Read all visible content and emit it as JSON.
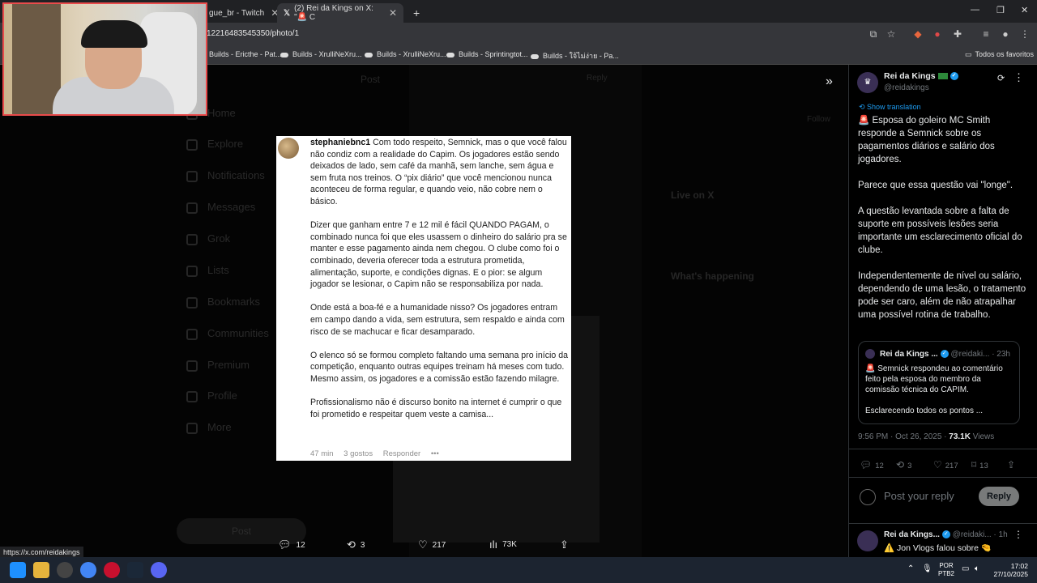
{
  "browser": {
    "tabs": [
      {
        "title": "gue_br - Twitch"
      },
      {
        "title": "(2) Rei da Kings on X: \"🚨 C"
      }
    ],
    "url": "12216483545350/photo/1",
    "bookmarks": [
      "Builds - Ericthe - Pat...",
      "Builds - XrulliNeXru...",
      "Builds - XrulliNeXru...",
      "Builds - Sprintingtot...",
      "Builds - ใจ้ไม่ง่าย - Pa..."
    ],
    "all_bookmarks": "Todos os favoritos"
  },
  "background": {
    "nav": [
      "Home",
      "Explore",
      "Notifications",
      "Messages",
      "Grok",
      "Lists",
      "Bookmarks",
      "Communities",
      "Premium",
      "Profile",
      "More"
    ],
    "post_button": "Post",
    "header": "Post",
    "reply": "Reply",
    "follow": "Follow",
    "live_on_x": "Live on X",
    "whats_happening": "What's happening"
  },
  "comment": {
    "username": "stephaniebnc1",
    "paragraphs": [
      "Com todo respeito, Semnick, mas o que você falou não condiz com a realidade do Capim. Os jogadores estão sendo deixados de lado, sem café da manhã, sem lanche, sem água e sem fruta nos treinos. O “pix diário” que você mencionou nunca aconteceu de forma regular, e quando veio, não cobre nem o básico.",
      "Dizer que ganham entre 7 e 12 mil é fácil QUANDO PAGAM, o combinado nunca foi que eles usassem o dinheiro do salário pra se manter e esse pagamento ainda nem chegou. O clube como foi o combinado, deveria oferecer toda a estrutura prometida, alimentação, suporte, e condições dignas. E o pior: se algum jogador se lesionar, o Capim não se responsabiliza por nada.",
      "Onde está a boa-fé e a humanidade nisso? Os jogadores entram em campo dando a vida, sem estrutura, sem respaldo e ainda com risco de se machucar e ficar desamparado.",
      "O elenco só se formou completo faltando uma semana pro início da competição, enquanto outras equipes treinam há meses com tudo. Mesmo assim, os jogadores e a comissão estão fazendo milagre.",
      "Profissionalismo não é discurso bonito na internet é cumprir o que foi prometido e respeitar quem veste a camisa..."
    ],
    "time": "47 min",
    "likes": "3 gostos",
    "reply": "Responder",
    "more": "•••"
  },
  "bottom_actions": {
    "replies": "12",
    "reposts": "3",
    "likes": "217",
    "views": "73K"
  },
  "right_panel": {
    "author_name": "Rei da Kings",
    "author_handle": "@reidakings",
    "show_translation": "Show translation",
    "paragraphs": [
      "🚨 Esposa do goleiro MC Smith responde a Semnick sobre os pagamentos diários e salário dos jogadores.",
      "Parece que essa questão vai \"longe\".",
      "A questão levantada sobre a falta de suporte em possíveis lesões seria importante um esclarecimento oficial do clube.",
      "Independentemente de nível ou salário, dependendo de uma lesão, o tratamento pode ser caro, além de não atrapalhar uma possível rotina de trabalho."
    ],
    "quote": {
      "name": "Rei da Kings ...",
      "handle": "@reidaki...",
      "time": "· 23h",
      "paragraphs": [
        "🚨 Semnick respondeu ao comentário feito pela esposa do membro da comissão técnica do CAPIM.",
        "Esclarecendo todos os pontos ..."
      ]
    },
    "timestamp": "9:56 PM · Oct 26, 2025 ·",
    "views_count": "73.1K",
    "views_label": "Views",
    "stats": {
      "replies": "12",
      "reposts": "3",
      "likes": "217",
      "bookmarks": "13"
    },
    "reply_placeholder": "Post your reply",
    "reply_button": "Reply",
    "next_reply": {
      "name": "Rei da Kings...",
      "handle": "@reidaki...",
      "time": "· 1h",
      "text": "⚠️ Jon Vlogs falou sobre 🤏"
    }
  },
  "status_url": "https://x.com/reidakings",
  "taskbar": {
    "lang_line1": "POR",
    "lang_line2": "PTB2",
    "time": "17:02",
    "date": "27/10/2025"
  },
  "colors": {
    "accent": "#1d9bf0",
    "webcam_border": "#e94b4b",
    "panel_bg": "#000000"
  }
}
